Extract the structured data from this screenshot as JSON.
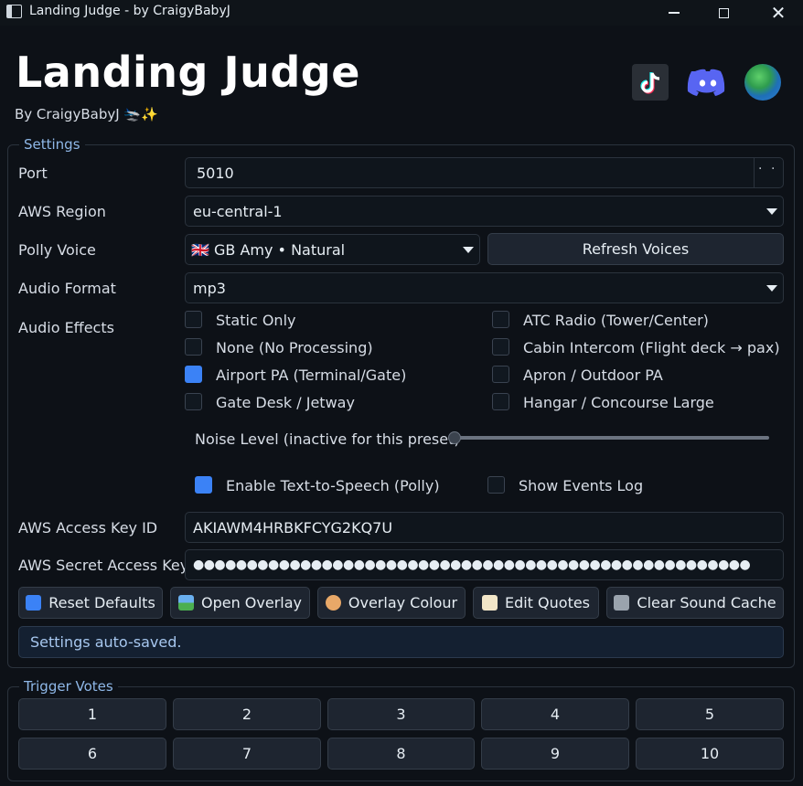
{
  "window": {
    "title": "Landing Judge - by CraigyBabyJ"
  },
  "header": {
    "title": "Landing Judge",
    "subtitle": "By CraigyBabyJ 🛬✨",
    "links": [
      "tiktok-icon",
      "discord-icon",
      "globe-icon"
    ]
  },
  "settings": {
    "group_label": "Settings",
    "port": {
      "label": "Port",
      "value": "5010"
    },
    "aws_region": {
      "label": "AWS Region",
      "value": "eu-central-1"
    },
    "polly_voice": {
      "label": "Polly Voice",
      "value": "🇬🇧 GB Amy • Natural",
      "refresh_label": "Refresh Voices"
    },
    "audio_format": {
      "label": "Audio Format",
      "value": "mp3"
    },
    "audio_effects": {
      "label": "Audio Effects",
      "options": [
        {
          "label": "Static Only",
          "checked": false
        },
        {
          "label": "ATC Radio (Tower/Center)",
          "checked": false
        },
        {
          "label": "None (No Processing)",
          "checked": false
        },
        {
          "label": "Cabin Intercom (Flight deck → pax)",
          "checked": false
        },
        {
          "label": "Airport PA (Terminal/Gate)",
          "checked": true
        },
        {
          "label": "Apron / Outdoor PA",
          "checked": false
        },
        {
          "label": "Gate Desk / Jetway",
          "checked": false
        },
        {
          "label": "Hangar / Concourse Large",
          "checked": false
        }
      ]
    },
    "noise_level": {
      "label": "Noise Level (inactive for this preset)",
      "value": 0
    },
    "enable_tts": {
      "label": "Enable Text-to-Speech (Polly)",
      "checked": true
    },
    "show_events_log": {
      "label": "Show Events Log",
      "checked": false
    },
    "access_key": {
      "label": "AWS Access Key ID",
      "value": "AKIAWM4HRBKFCYG2KQ7U"
    },
    "secret_key": {
      "label": "AWS Secret Access Key",
      "value": "●●●●●●●●●●●●●●●●●●●●●●●●●●●●●●●●●●●●●●●●●●●●●●●●●●●●"
    },
    "buttons": {
      "reset": "Reset Defaults",
      "overlay": "Open Overlay",
      "colour": "Overlay Colour",
      "quotes": "Edit Quotes",
      "clear_cache": "Clear Sound Cache"
    },
    "status": "Settings auto-saved."
  },
  "trigger_votes": {
    "group_label": "Trigger Votes",
    "buttons": [
      "1",
      "2",
      "3",
      "4",
      "5",
      "6",
      "7",
      "8",
      "9",
      "10"
    ]
  },
  "colors": {
    "accent": "#3b82f6",
    "background": "#0d1117",
    "group_label": "#8fb8e8"
  }
}
